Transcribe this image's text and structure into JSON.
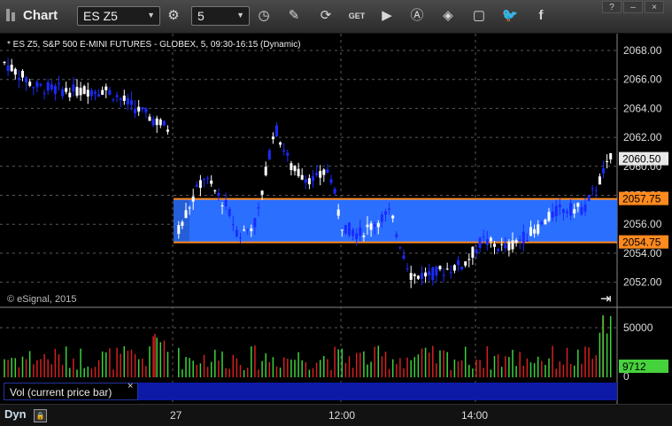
{
  "toolbar": {
    "app_title": "Chart",
    "symbol": "ES Z5",
    "interval": "5",
    "icons": [
      "settings-gear-icon",
      "clock-icon",
      "pencil-icon",
      "refresh-icon",
      "get-icon",
      "play-icon",
      "a-circle-icon",
      "tag-icon",
      "comment-icon",
      "twitter-icon",
      "facebook-icon"
    ],
    "window_controls": [
      "?",
      "–",
      "×"
    ]
  },
  "chart": {
    "header": "* ES Z5, S&P 500 E-MINI FUTURES - GLOBEX, 5, 09:30-16:15 (Dynamic)",
    "copyright": "© eSignal, 2015",
    "price_axis": [
      "2068.00",
      "2066.00",
      "2064.00",
      "2062.00",
      "2060.00",
      "2058.00",
      "2056.00",
      "2054.00",
      "2052.00"
    ],
    "last_price": "2060.50",
    "band_upper": "2057.75",
    "band_lower": "2054.75",
    "volume_axis": [
      "50000",
      "0"
    ],
    "volume_last": "9712",
    "time_axis": [
      "27",
      "12:00",
      "14:00"
    ],
    "colors": {
      "up": "#ffffff",
      "down": "#1a2bff",
      "band": "#2b6fff",
      "band_line": "#ff8a1f",
      "vol_up": "#3cd23c",
      "vol_down": "#d42020",
      "grid": "#5a5a5a"
    }
  },
  "legend": {
    "label": "Vol (current price bar)",
    "close": "×"
  },
  "bottom": {
    "dyn": "Dyn",
    "dyn_icon": "lock-icon"
  },
  "candles_up_ratio": 0.55
}
